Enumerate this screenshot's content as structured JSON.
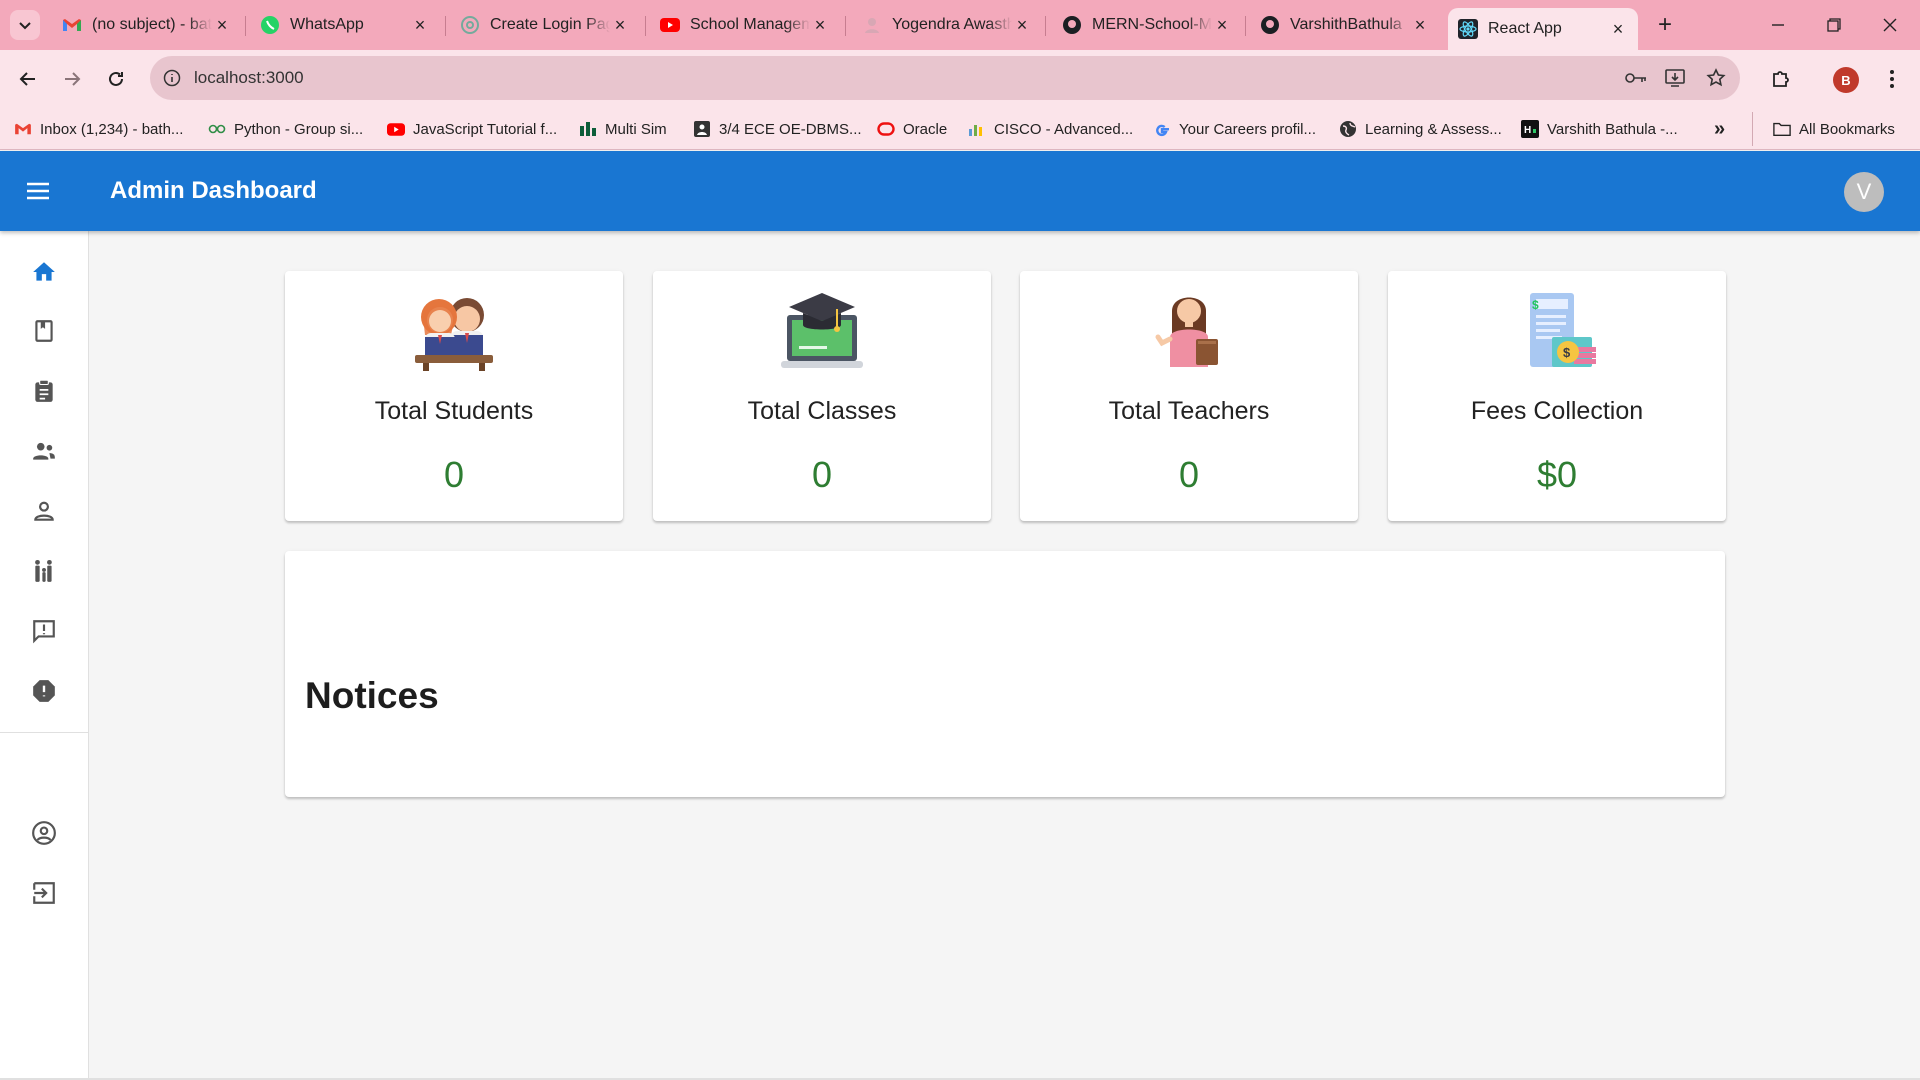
{
  "browser": {
    "tabs": [
      {
        "title": "(no subject) - bathula",
        "icon": "gmail-icon"
      },
      {
        "title": "WhatsApp",
        "icon": "whatsapp-icon"
      },
      {
        "title": "Create Login Page",
        "icon": "chatgpt-icon"
      },
      {
        "title": "School Management",
        "icon": "youtube-icon"
      },
      {
        "title": "Yogendra Awasthi",
        "icon": "profile-icon"
      },
      {
        "title": "MERN-School-Management",
        "icon": "github-icon"
      },
      {
        "title": "VarshithBathula",
        "icon": "github-icon"
      },
      {
        "title": "React App",
        "icon": "react-icon"
      }
    ],
    "url": "localhost:3000",
    "profile_initial": "B",
    "bookmarks": [
      {
        "label": "Inbox (1,234) - bath...",
        "icon": "gmail-icon"
      },
      {
        "label": "Python - Group si...",
        "icon": "python-icon"
      },
      {
        "label": "JavaScript Tutorial f...",
        "icon": "youtube-icon"
      },
      {
        "label": "Multi Sim",
        "icon": "multisim-icon"
      },
      {
        "label": "3/4 ECE OE-DBMS...",
        "icon": "classroom-icon"
      },
      {
        "label": "Oracle",
        "icon": "oracle-icon"
      },
      {
        "label": "CISCO - Advanced...",
        "icon": "chart-icon"
      },
      {
        "label": "Your Careers profil...",
        "icon": "google-icon"
      },
      {
        "label": "Learning & Assess...",
        "icon": "globe-icon"
      },
      {
        "label": "Varshith Bathula -...",
        "icon": "hackerrank-icon"
      }
    ],
    "more_bookmarks": "»",
    "all_bookmarks": "All Bookmarks"
  },
  "app": {
    "title": "Admin Dashboard",
    "avatar_initial": "V",
    "brand_color": "#1976d2",
    "value_color": "#2e7d32"
  },
  "sidebar": {
    "items": [
      {
        "name": "home",
        "icon": "home-icon"
      },
      {
        "name": "classes",
        "icon": "class-book-icon"
      },
      {
        "name": "subjects",
        "icon": "clipboard-icon"
      },
      {
        "name": "teachers",
        "icon": "supervisor-icon"
      },
      {
        "name": "students",
        "icon": "person-icon"
      },
      {
        "name": "parents",
        "icon": "family-icon"
      },
      {
        "name": "notices",
        "icon": "announcement-icon"
      },
      {
        "name": "complains",
        "icon": "report-icon"
      },
      {
        "name": "profile",
        "icon": "account-circle-icon"
      },
      {
        "name": "logout",
        "icon": "logout-icon"
      }
    ]
  },
  "stats": {
    "students": {
      "label": "Total Students",
      "value": "0"
    },
    "classes": {
      "label": "Total Classes",
      "value": "0"
    },
    "teachers": {
      "label": "Total Teachers",
      "value": "0"
    },
    "fees": {
      "label": "Fees Collection",
      "value": "$0"
    }
  },
  "notices": {
    "title": "Notices"
  }
}
